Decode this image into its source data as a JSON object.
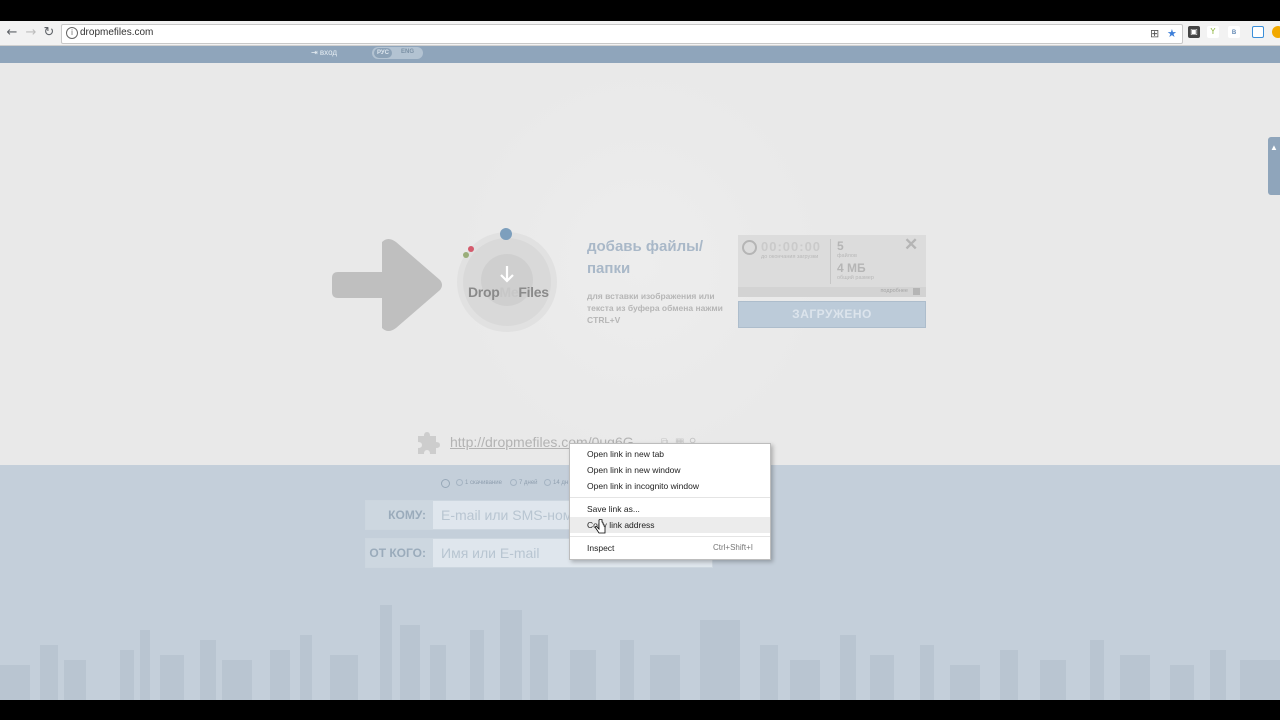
{
  "browser": {
    "url": "dropmefiles.com",
    "back_glyph": "←",
    "forward_glyph": "→",
    "reload_glyph": "↻"
  },
  "header": {
    "login_label": "⇥ вход",
    "langs": [
      "РУС",
      "ENG"
    ]
  },
  "logo": {
    "part1": "Drop",
    "part2": "Me",
    "part3": "Files"
  },
  "upload": {
    "title": "добавь файлы/папки",
    "hint": "для вставки изображения или текста из буфера обмена нажми CTRL+V",
    "timer": "00:00:00",
    "timer_caption": "до окончания загрузки",
    "files_count": "5",
    "files_caption": "файлов",
    "size": "4 МБ",
    "size_caption": "общий размер",
    "more_label": "подробнее",
    "close_glyph": "✕",
    "button_label": "ЗАГРУЖЕНО"
  },
  "share": {
    "link": "http://dropmefiles.com/0ug6G"
  },
  "options": [
    "1 скачивание",
    "7 дней",
    "14 дн"
  ],
  "form": {
    "to_label": "КОМУ:",
    "to_placeholder": "E-mail или SMS-номер",
    "from_label": "ОТ КОГО:",
    "from_placeholder": "Имя или E-mail"
  },
  "context_menu": {
    "items": [
      {
        "label": "Open link in new tab",
        "shortcut": ""
      },
      {
        "label": "Open link in new window",
        "shortcut": ""
      },
      {
        "label": "Open link in incognito window",
        "shortcut": ""
      },
      {
        "label": "Save link as...",
        "shortcut": ""
      },
      {
        "label": "Copy link address",
        "shortcut": ""
      },
      {
        "label": "Inspect",
        "shortcut": "Ctrl+Shift+I"
      }
    ]
  },
  "colors": {
    "header_bar": "#8fa5bb",
    "accent_text": "#a9b8c8",
    "lower_panel": "#c4cfda"
  },
  "icons": [
    "back-icon",
    "forward-icon",
    "reload-icon",
    "info-icon",
    "translate-icon",
    "star-icon",
    "puzzle-icon",
    "clock-icon",
    "close-icon",
    "cursor-icon"
  ]
}
